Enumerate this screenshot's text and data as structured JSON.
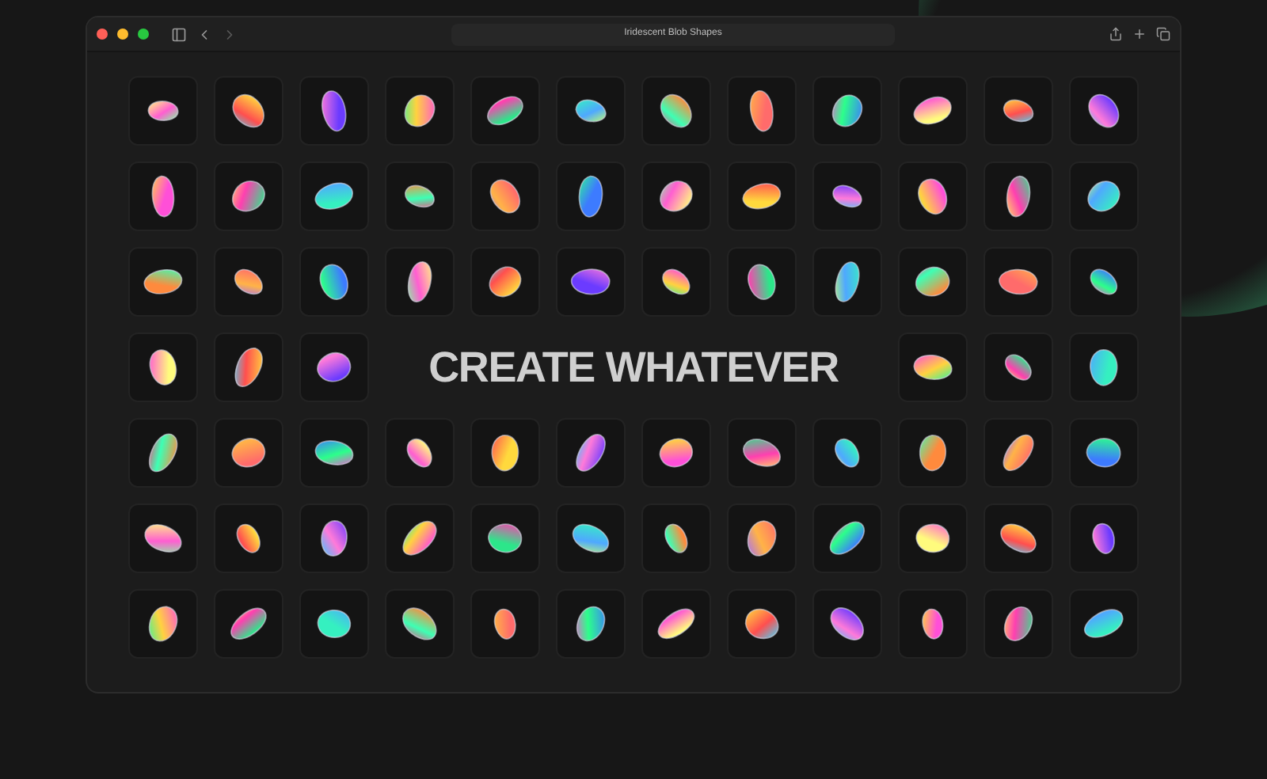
{
  "window": {
    "title": "Iridescent Blob Shapes"
  },
  "headline": "CREATE WHATEVER"
}
